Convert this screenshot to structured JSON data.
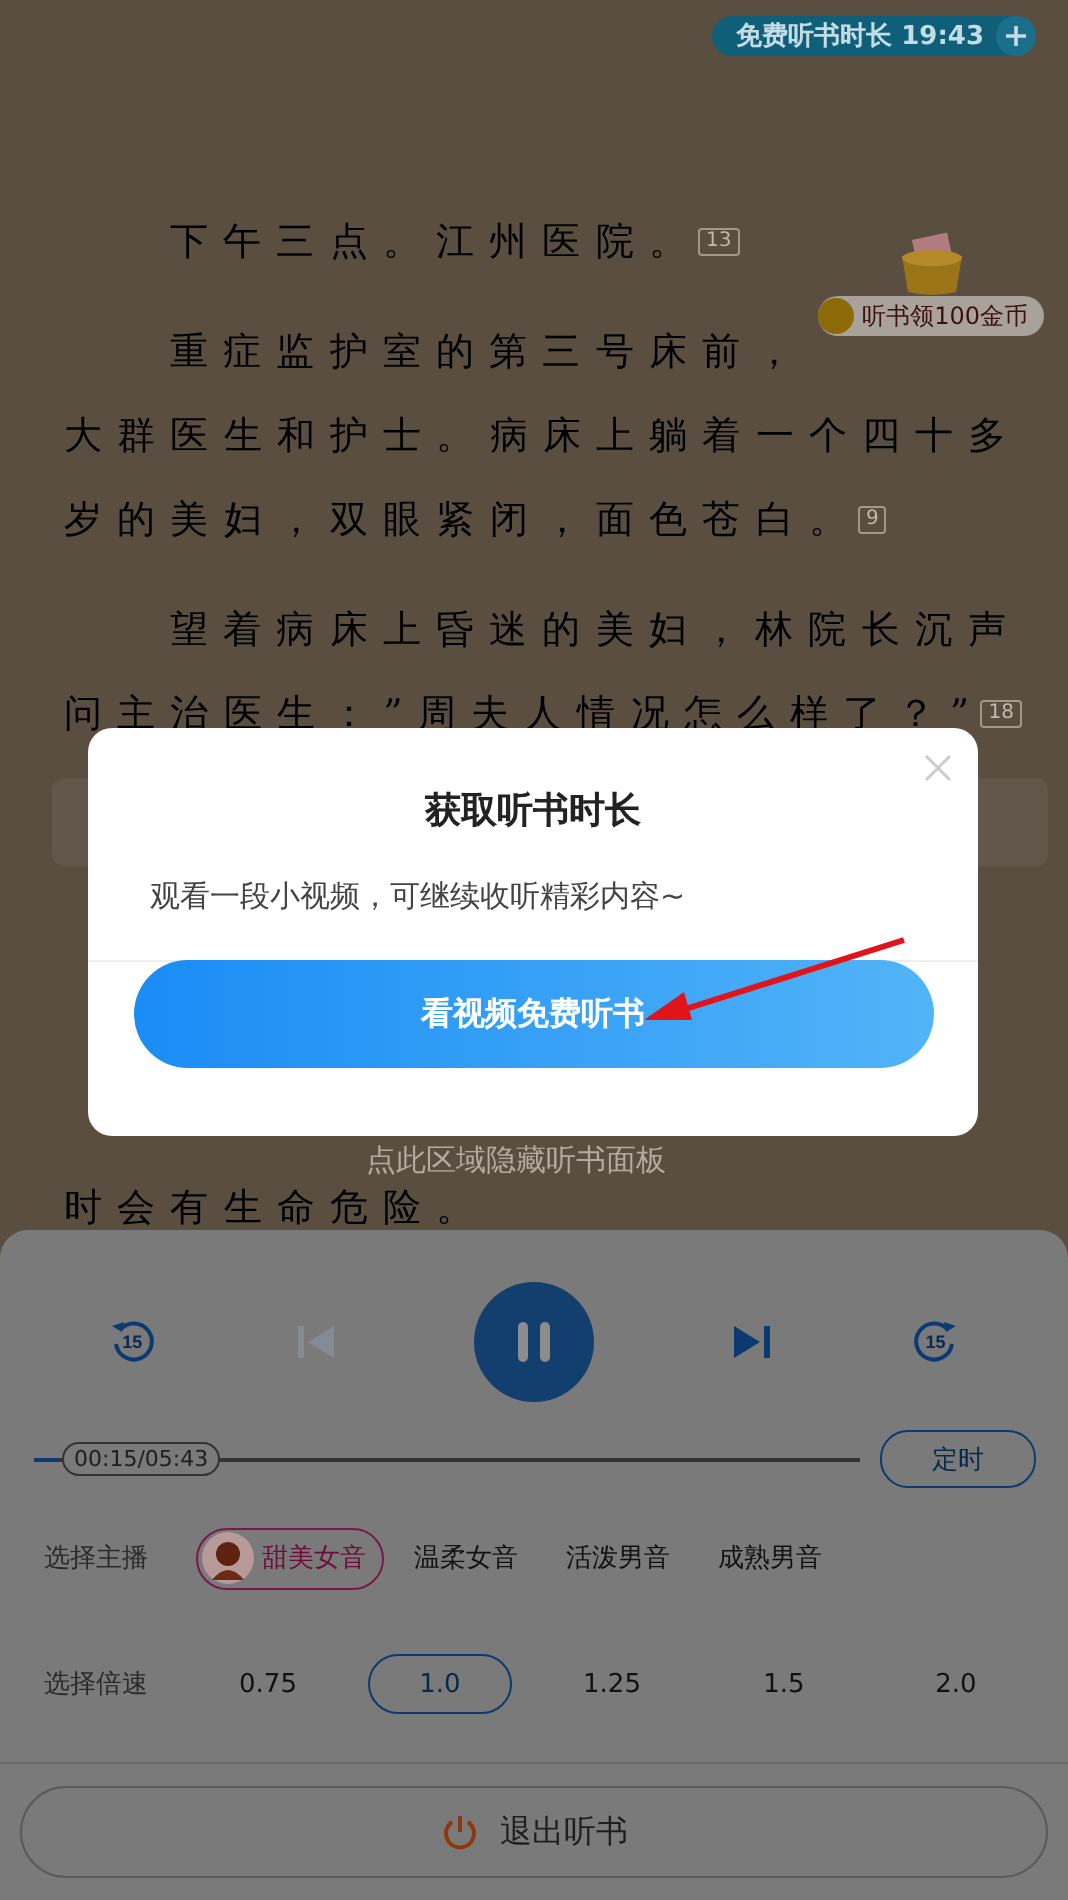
{
  "listen_time_pill": {
    "label": "免费听书时长 19:43"
  },
  "coin_reward": {
    "label": "听书领100金币"
  },
  "paragraphs": [
    {
      "lines": [
        "下午三点。江州医院。"
      ],
      "comment_count": "13"
    },
    {
      "lines": [
        "重症监护室的第三号床前，",
        "大群医生和护士。病床上躺着一个四十多",
        "岁的美妇，双眼紧闭，面色苍白。"
      ],
      "comment_count": "9"
    },
    {
      "lines": [
        "望着病床上昏迷的美妇，林院长沉声",
        "问主治医生：”周夫人情况怎么样了？”"
      ],
      "comment_count": "18"
    }
  ],
  "covered_lines": [
    {
      "left": "时会有生命危险。"
    }
  ],
  "hide_hint": "点此区域隐藏听书面板",
  "dialog": {
    "title": "获取听书时长",
    "message": "观看一段小视频，可继续收听精彩内容~",
    "button": "看视频免费听书"
  },
  "player": {
    "controls": [
      {
        "kind": "rewind",
        "label": "15",
        "disabled": false
      },
      {
        "kind": "previous",
        "disabled": true
      },
      {
        "kind": "pause",
        "disabled": false
      },
      {
        "kind": "next",
        "disabled": false
      },
      {
        "kind": "forward",
        "label": "15",
        "disabled": false
      }
    ],
    "progress": {
      "level": 0.03,
      "time": "00:15/05:43"
    },
    "timer_button": "定时",
    "narrators": {
      "label": "选择主播",
      "options": [
        {
          "label": "甜美女音",
          "selected": true
        },
        {
          "label": "温柔女音",
          "selected": false
        },
        {
          "label": "活泼男音",
          "selected": false
        },
        {
          "label": "成熟男音",
          "selected": false
        }
      ]
    },
    "speeds": {
      "label": "选择倍速",
      "options": [
        {
          "label": "0.75",
          "selected": false
        },
        {
          "label": "1.0",
          "selected": true
        },
        {
          "label": "1.25",
          "selected": false
        },
        {
          "label": "1.5",
          "selected": false
        },
        {
          "label": "2.0",
          "selected": false
        }
      ]
    },
    "exit_button": "退出听书"
  }
}
